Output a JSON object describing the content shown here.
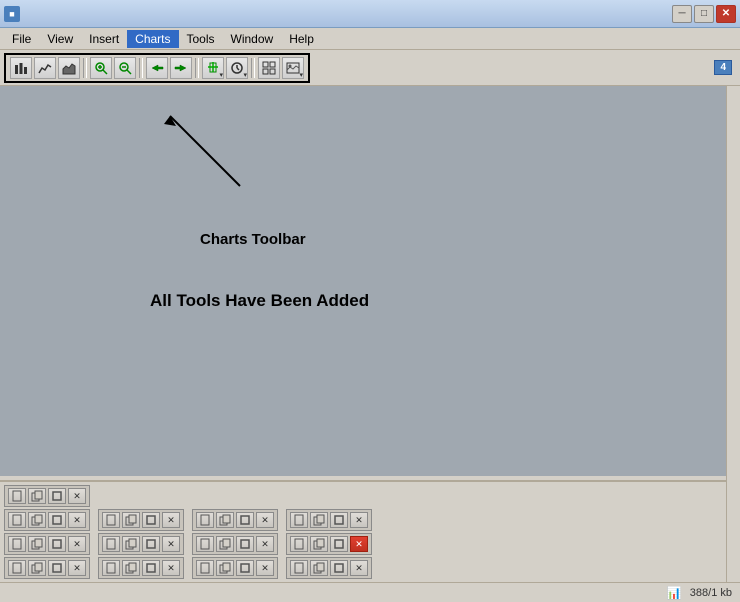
{
  "titleBar": {
    "text": "",
    "minimizeLabel": "─",
    "maximizeLabel": "□",
    "closeLabel": "✕"
  },
  "menuBar": {
    "items": [
      {
        "label": "File",
        "name": "file"
      },
      {
        "label": "View",
        "name": "view"
      },
      {
        "label": "Insert",
        "name": "insert"
      },
      {
        "label": "Charts",
        "name": "charts",
        "active": true
      },
      {
        "label": "Tools",
        "name": "tools"
      },
      {
        "label": "Window",
        "name": "window"
      },
      {
        "label": "Help",
        "name": "help"
      }
    ]
  },
  "toolbar": {
    "badge": "4",
    "buttons": [
      {
        "icon": "📊",
        "title": "Bar Chart"
      },
      {
        "icon": "📈",
        "title": "Line Chart"
      },
      {
        "icon": "📉",
        "title": "Area Chart"
      },
      {
        "icon": "🔍",
        "title": "Zoom In"
      },
      {
        "icon": "🔎",
        "title": "Zoom Out"
      },
      {
        "icon": "➜",
        "title": "Arrow"
      },
      {
        "icon": "⟵",
        "title": "Back Arrow"
      },
      {
        "icon": "➕",
        "title": "Add"
      },
      {
        "icon": "🕐",
        "title": "Clock"
      },
      {
        "icon": "▦",
        "title": "Grid"
      },
      {
        "icon": "🖼",
        "title": "Image"
      }
    ]
  },
  "annotation": {
    "toolbar_label": "Charts Toolbar",
    "main_label": "All Tools Have Been Added"
  },
  "statusBar": {
    "info": "388/1 kb"
  },
  "bottomPanel": {
    "rows": [
      {
        "groups": [
          {
            "buttons": [
              "doc",
              "copy",
              "square",
              "close"
            ]
          }
        ]
      },
      {
        "groups": [
          {
            "buttons": [
              "doc",
              "copy",
              "square",
              "close"
            ]
          },
          {
            "buttons": [
              "doc",
              "copy",
              "square",
              "close"
            ]
          },
          {
            "buttons": [
              "doc",
              "copy",
              "square",
              "close"
            ]
          },
          {
            "buttons": [
              "doc",
              "copy",
              "square",
              "close-red"
            ]
          }
        ]
      },
      {
        "groups": [
          {
            "buttons": [
              "doc",
              "copy",
              "square",
              "close"
            ]
          },
          {
            "buttons": [
              "doc",
              "copy",
              "square",
              "close"
            ]
          },
          {
            "buttons": [
              "doc",
              "copy",
              "square",
              "close"
            ]
          },
          {
            "buttons": [
              "doc",
              "copy",
              "square",
              "close-red"
            ]
          }
        ]
      },
      {
        "groups": [
          {
            "buttons": [
              "doc",
              "copy",
              "square",
              "close"
            ]
          },
          {
            "buttons": [
              "doc",
              "copy",
              "square",
              "close"
            ]
          },
          {
            "buttons": [
              "doc",
              "copy",
              "square",
              "close"
            ]
          },
          {
            "buttons": [
              "doc",
              "copy",
              "square",
              "close"
            ]
          }
        ]
      }
    ]
  }
}
